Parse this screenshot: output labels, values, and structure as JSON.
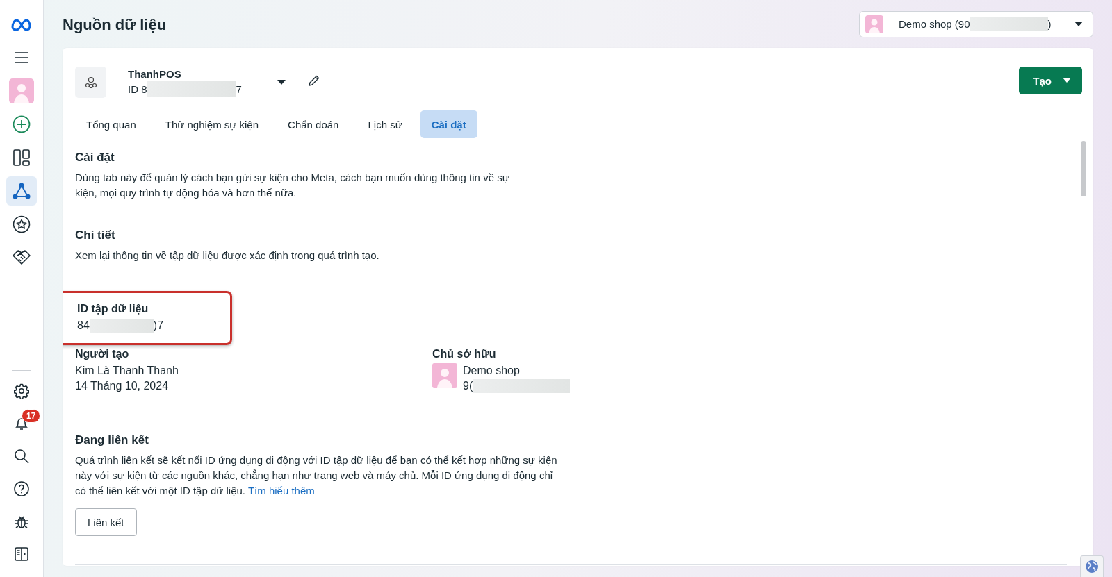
{
  "sidebar": {
    "top": [
      {
        "kind": "meta",
        "selected": false
      },
      {
        "kind": "menu",
        "selected": false
      },
      {
        "kind": "avatar",
        "selected": false
      },
      {
        "kind": "plus",
        "selected": false
      },
      {
        "kind": "layout",
        "selected": false
      },
      {
        "kind": "graph",
        "selected": true
      },
      {
        "kind": "star",
        "selected": false
      },
      {
        "kind": "handshake",
        "selected": false
      }
    ],
    "bottom": [
      {
        "kind": "gear"
      },
      {
        "kind": "bell",
        "badge": "17"
      },
      {
        "kind": "search"
      },
      {
        "kind": "help"
      },
      {
        "kind": "bug"
      },
      {
        "kind": "panel"
      }
    ]
  },
  "page_title": "Nguồn dữ liệu",
  "account_selector": {
    "label_start": "Demo shop (90",
    "label_end": ")"
  },
  "dataset": {
    "name": "ThanhPOS",
    "id_start": "ID 8",
    "id_end": "7"
  },
  "create_button": "Tạo",
  "tabs": [
    {
      "label": "Tổng quan",
      "selected": false
    },
    {
      "label": "Thử nghiệm sự kiện",
      "selected": false
    },
    {
      "label": "Chẩn đoán",
      "selected": false
    },
    {
      "label": "Lịch sử",
      "selected": false
    },
    {
      "label": "Cài đặt",
      "selected": true
    }
  ],
  "settings": {
    "title": "Cài đặt",
    "description": "Dùng tab này để quản lý cách bạn gửi sự kiện cho Meta, cách bạn muốn dùng thông tin về sự kiện, mọi quy trình tự động hóa và hơn thế nữa."
  },
  "details": {
    "title": "Chi tiết",
    "description": "Xem lại thông tin về tập dữ liệu được xác định trong quá trình tạo.",
    "dataset_id": {
      "label": "ID tập dữ liệu",
      "value_start": "84",
      "value_end": ")7",
      "highlighted": true
    },
    "creator": {
      "label": "Người tạo",
      "name": "Kim Là Thanh Thanh",
      "date": "14 Tháng 10, 2024"
    },
    "owner": {
      "label": "Chủ sở hữu",
      "name": "Demo shop",
      "id_start": "9("
    }
  },
  "linking": {
    "title": "Đang liên kết",
    "description": "Quá trình liên kết sẽ kết nối ID ứng dụng di động với ID tập dữ liệu để bạn có thể kết hợp những sự kiện này với sự kiện từ các nguồn khác, chẳng hạn như trang web và máy chủ. Mỗi ID ứng dụng di động chỉ có thể liên kết với một ID tập dữ liệu.",
    "link": "Tìm hiểu thêm",
    "button": "Liên kết"
  }
}
